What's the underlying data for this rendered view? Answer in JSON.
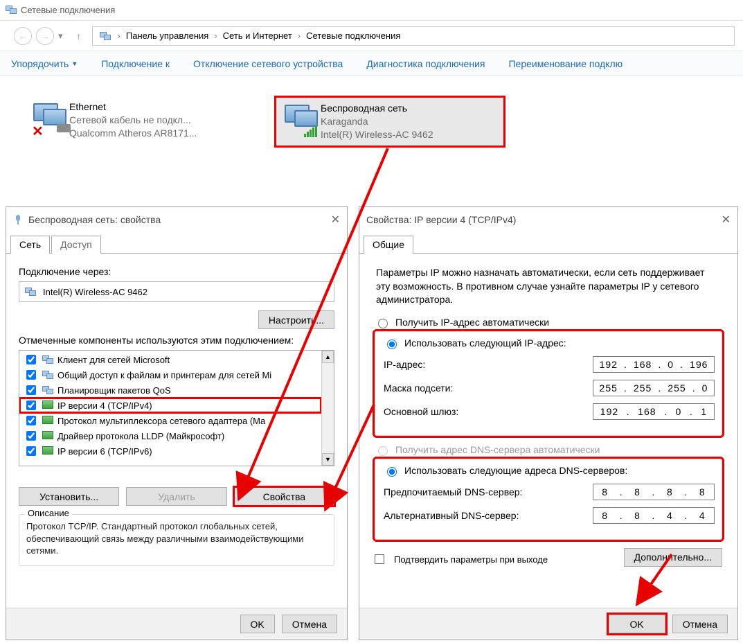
{
  "window": {
    "title": "Сетевые подключения"
  },
  "breadcrumb": {
    "seg1": "Панель управления",
    "seg2": "Сеть и Интернет",
    "seg3": "Сетевые подключения"
  },
  "toolbar": {
    "organize": "Упорядочить",
    "connect": "Подключение к",
    "disable": "Отключение сетевого устройства",
    "diagnose": "Диагностика подключения",
    "rename": "Переименование подклю"
  },
  "connections": {
    "ethernet": {
      "name": "Ethernet",
      "status": "Сетевой кабель не подкл...",
      "hw": "Qualcomm Atheros AR8171..."
    },
    "wifi": {
      "name": "Беспроводная сеть",
      "status": "Karaganda",
      "hw": "Intel(R) Wireless-AC 9462"
    }
  },
  "props": {
    "title": "Беспроводная сеть: свойства",
    "tab_net": "Сеть",
    "tab_access": "Доступ",
    "connect_via": "Подключение через:",
    "adapter": "Intel(R) Wireless-AC 9462",
    "configure": "Настроить...",
    "components_label": "Отмеченные компоненты используются этим подключением:",
    "items": [
      "Клиент для сетей Microsoft",
      "Общий доступ к файлам и принтерам для сетей Mi",
      "Планировщик пакетов QoS",
      "IP версии 4 (TCP/IPv4)",
      "Протокол мультиплексора сетевого адаптера (Ma",
      "Драйвер протокола LLDP (Майкрософт)",
      "IP версии 6 (TCP/IPv6)"
    ],
    "install": "Установить...",
    "remove": "Удалить",
    "properties": "Свойства",
    "desc_legend": "Описание",
    "desc": "Протокол TCP/IP. Стандартный протокол глобальных сетей, обеспечивающий связь между различными взаимодействующими сетями.",
    "ok": "OK",
    "cancel": "Отмена"
  },
  "ipv4": {
    "title": "Свойства: IP версии 4 (TCP/IPv4)",
    "tab_general": "Общие",
    "intro": "Параметры IP можно назначать автоматически, если сеть поддерживает эту возможность. В противном случае узнайте параметры IP у сетевого администратора.",
    "r_auto_ip": "Получить IP-адрес автоматически",
    "r_manual_ip": "Использовать следующий IP-адрес:",
    "f_ip": "IP-адрес:",
    "f_mask": "Маска подсети:",
    "f_gw": "Основной шлюз:",
    "v_ip": [
      "192",
      "168",
      "0",
      "196"
    ],
    "v_mask": [
      "255",
      "255",
      "255",
      "0"
    ],
    "v_gw": [
      "192",
      "168",
      "0",
      "1"
    ],
    "r_auto_dns": "Получить адрес DNS-сервера автоматически",
    "r_manual_dns": "Использовать следующие адреса DNS-серверов:",
    "f_dns1": "Предпочитаемый DNS-сервер:",
    "f_dns2": "Альтернативный DNS-сервер:",
    "v_dns1": [
      "8",
      "8",
      "8",
      "8"
    ],
    "v_dns2": [
      "8",
      "8",
      "4",
      "4"
    ],
    "confirm_exit": "Подтвердить параметры при выходе",
    "advanced": "Дополнительно...",
    "ok": "OK",
    "cancel": "Отмена"
  }
}
